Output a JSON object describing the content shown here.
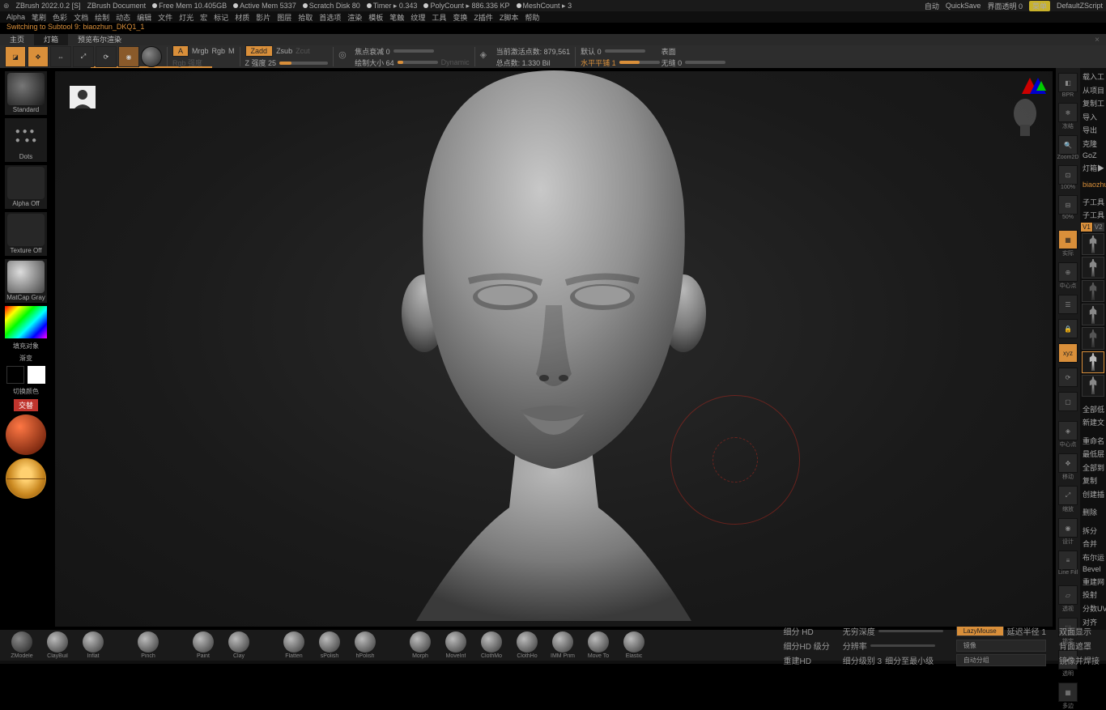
{
  "title_bar": {
    "app": "ZBrush 2022.0.2 [S]",
    "doc": "ZBrush Document",
    "free_mem": "Free Mem 10.405GB",
    "active_mem": "Active Mem 5337",
    "scratch": "Scratch Disk 80",
    "timer": "Timer ▸ 0.343",
    "polycount": "PolyCount ▸ 886.336 KP",
    "meshcount": "MeshCount ▸ 3",
    "auto": "自动",
    "quicksave": "QuickSave",
    "ui_transparent": "界面透明 0",
    "menu": "菜单",
    "zscript": "DefaultZScript"
  },
  "menu": [
    "Alpha",
    "笔刷",
    "色彩",
    "文档",
    "绘制",
    "动态",
    "编辑",
    "文件",
    "灯光",
    "宏",
    "标记",
    "材质",
    "影片",
    "图层",
    "拾取",
    "首选项",
    "渲染",
    "模板",
    "笔触",
    "纹理",
    "工具",
    "变换",
    "Z插件",
    "Z脚本",
    "帮助"
  ],
  "switching_line": {
    "label": "Switching to Subtool 9:",
    "name": "biaozhun_DKQ1_1"
  },
  "tabs": {
    "home": "主页",
    "lightbox": "灯箱",
    "preview": "预览布尔渲染"
  },
  "toolbar": {
    "a": "A",
    "mrgb": "Mrgb",
    "rgb": "Rgb",
    "m": "M",
    "rgb_intensity": "Rgb 强度",
    "zadd": "Zadd",
    "zsub": "Zsub",
    "zcut": "Zcut",
    "z_intensity": "Z 强度 25",
    "focal": "焦点衰减 0",
    "draw": "绘制大小 64",
    "dynamic": "Dynamic",
    "active_pts": "当前激活点数: 879,561",
    "total_pts": "总点数: 1.330 Bil",
    "mru": "默认 0",
    "hpan": "水平平铺 1",
    "surface": "表面",
    "noshade": "无缝 0"
  },
  "left": {
    "standard": "Standard",
    "dots": "Dots",
    "alpha_off": "Alpha Off",
    "texture_off": "Texture Off",
    "matcap": "MatCap Gray",
    "fill": "填充对象",
    "gradient": "渐变",
    "swap": "切换颜色",
    "alt": "交替"
  },
  "right_shelf": {
    "bpr": "BPR",
    "freeze": "冻结",
    "zoom2d": "Zoom2D",
    "sc100": "100%",
    "sc50": "50%",
    "frame": "实际",
    "center": "中心点",
    "move": "移动",
    "scale": "缩放",
    "rotate": "设计",
    "lineFill": "Line Fill",
    "persp": "透视",
    "lock": "锁定",
    "xyz": "xyz",
    "transp": "透明",
    "wire": "多边"
  },
  "right_panel_top": [
    "载入工",
    "从项目",
    "复制工",
    "导入",
    "导出",
    "克隆",
    "GoZ",
    "灯箱▶",
    "biaozhun"
  ],
  "right_panel_sub": {
    "v1": "V1",
    "v2": "V2",
    "sub": "子工具",
    "subtool": "子工具"
  },
  "right_panel_bottom": [
    "全部低",
    "新建文",
    "",
    "重命名",
    "最低层",
    "全部到",
    "复制",
    "创建插",
    "",
    "删除",
    "",
    "拆分",
    "合并",
    "布尔运",
    "Bevel",
    "重建网",
    "投射",
    "分数UV",
    "对齐"
  ],
  "bottom_shelf": {
    "brushes": [
      "ZModele",
      "ClayBuil",
      "Inflat",
      "",
      "Pinch",
      "",
      "Paint",
      "Clay",
      "",
      "Flatten",
      "sPolish",
      "hPolish",
      "",
      "Morph",
      "MoveInf",
      "ClothMo",
      "ClothHo",
      "IMM Prim",
      "Move To",
      "Elastic"
    ],
    "divide_hd": "细分 HD",
    "divide_hd_res": "细分HD 级分",
    "reconstruct": "重建HD",
    "inf_depth": "无穷深度",
    "resolution": "分辨率",
    "div_level": "细分级别 3",
    "rebuild_low": "细分至最小级",
    "lazymouse": "LazyMouse",
    "lazy_radius": "延迟半径 1",
    "two_sided": "双面显示",
    "mirror": "镜像",
    "back_mask": "背面遮罩",
    "auto_group": "自动分组",
    "mirror_weld": "镜像并焊接"
  }
}
